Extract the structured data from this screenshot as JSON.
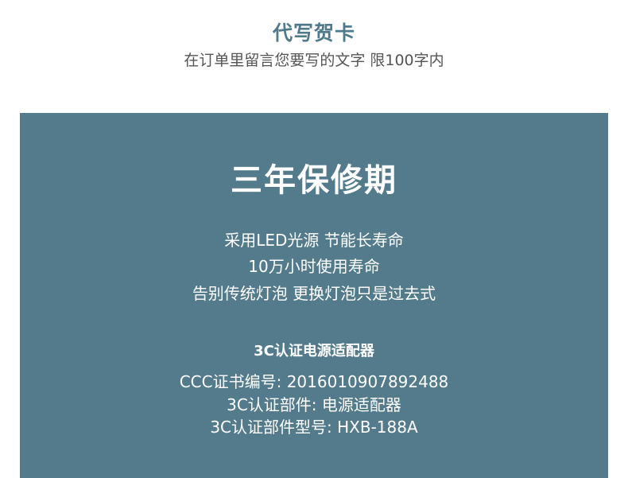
{
  "header": {
    "title": "代写贺卡",
    "subtitle": "在订单里留言您要写的文字 限100字内"
  },
  "warranty": {
    "title": "三年保修期",
    "features": [
      "采用LED光源 节能长寿命",
      "10万小时使用寿命",
      "告别传统灯泡 更换灯泡只是过去式"
    ]
  },
  "certification": {
    "heading": "3C认证电源适配器",
    "lines": [
      "CCC证书编号: 2016010907892488",
      "3C认证部件: 电源适配器",
      "3C认证部件型号: HXB-188A"
    ]
  },
  "colors": {
    "panel_background": "#537b8c",
    "header_title": "#4f7a8c",
    "header_subtitle": "#555555",
    "panel_text": "#ffffff"
  }
}
